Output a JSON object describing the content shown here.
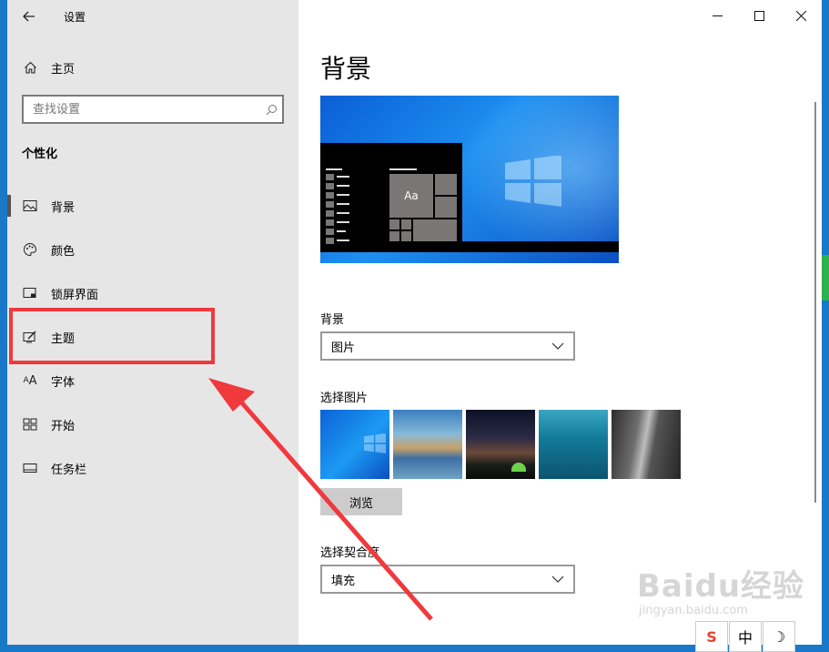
{
  "window": {
    "title": "设置",
    "back_icon": "back-arrow-icon",
    "controls": [
      "minimize",
      "maximize",
      "close"
    ]
  },
  "sidebar": {
    "home_label": "主页",
    "search_placeholder": "查找设置",
    "section_title": "个性化",
    "items": [
      {
        "label": "背景",
        "icon": "picture-icon",
        "selected": true
      },
      {
        "label": "颜色",
        "icon": "palette-icon",
        "selected": false
      },
      {
        "label": "锁屏界面",
        "icon": "lock-screen-icon",
        "selected": false
      },
      {
        "label": "主题",
        "icon": "theme-icon",
        "selected": false
      },
      {
        "label": "字体",
        "icon": "font-icon",
        "selected": false
      },
      {
        "label": "开始",
        "icon": "start-icon",
        "selected": false
      },
      {
        "label": "任务栏",
        "icon": "taskbar-icon",
        "selected": false
      }
    ]
  },
  "main": {
    "title": "背景",
    "preview_tile_text": "Aa",
    "background_label": "背景",
    "background_value": "图片",
    "choose_picture_label": "选择图片",
    "browse_label": "浏览",
    "fit_label": "选择契合度",
    "fit_value": "填充"
  },
  "annotation": {
    "highlight_color": "#f0393d"
  },
  "watermark": {
    "main": "Baidu经验",
    "sub": "jingyan.baidu.com"
  },
  "ime": {
    "items": [
      "S",
      "中",
      "☽"
    ]
  }
}
